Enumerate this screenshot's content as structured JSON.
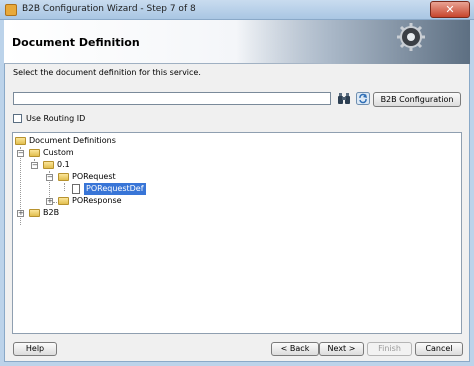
{
  "window": {
    "title": "B2B Configuration Wizard - Step 7 of 8",
    "close_glyph": "✕"
  },
  "header": {
    "title": "Document Definition"
  },
  "instruction": "Select the document definition for this service.",
  "definition_field": {
    "value": ""
  },
  "b2b_config_button": {
    "label": "B2B Configuration"
  },
  "routing": {
    "label": "Use Routing ID",
    "checked": false
  },
  "tree": {
    "root": "Document Definitions",
    "custom": "Custom",
    "version": "0.1",
    "porequest": "PORequest",
    "porequestdef": "PORequestDef",
    "poresponse": "POResponse",
    "b2b": "B2B"
  },
  "buttons": {
    "help": "Help",
    "back": "< Back",
    "next": "Next >",
    "finish": "Finish",
    "cancel": "Cancel"
  }
}
